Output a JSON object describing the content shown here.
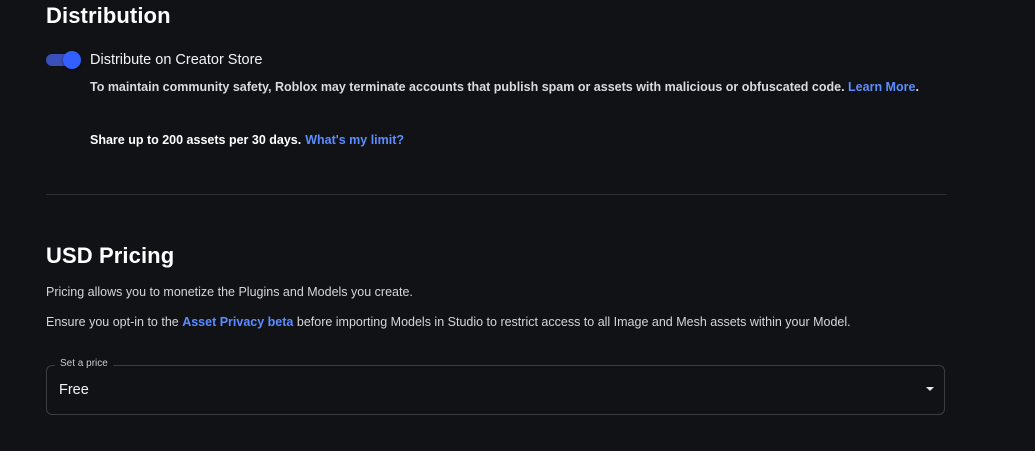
{
  "distribution": {
    "title": "Distribution",
    "toggle": {
      "label": "Distribute on Creator Store",
      "checked": true,
      "color": "#335fff"
    },
    "notice": {
      "text": "To maintain community safety, Roblox may terminate accounts that publish spam or assets with malicious or obfuscated code.",
      "link": "Learn More",
      "suffix": "."
    },
    "limit": {
      "text": "Share up to 200 assets per 30 days.",
      "link": "What's my limit?"
    }
  },
  "pricing": {
    "title": "USD Pricing",
    "description": "Pricing allows you to monetize the Plugins and Models you create.",
    "privacy": {
      "before": "Ensure you opt-in to the ",
      "link": "Asset Privacy beta",
      "after": " before importing Models in Studio to restrict access to all Image and Mesh assets within your Model."
    },
    "price_select": {
      "label": "Set a price",
      "value": "Free",
      "icon": "caret-down-icon"
    }
  },
  "colors": {
    "background": "#111216",
    "link": "#5c8cff",
    "accent": "#335fff"
  }
}
